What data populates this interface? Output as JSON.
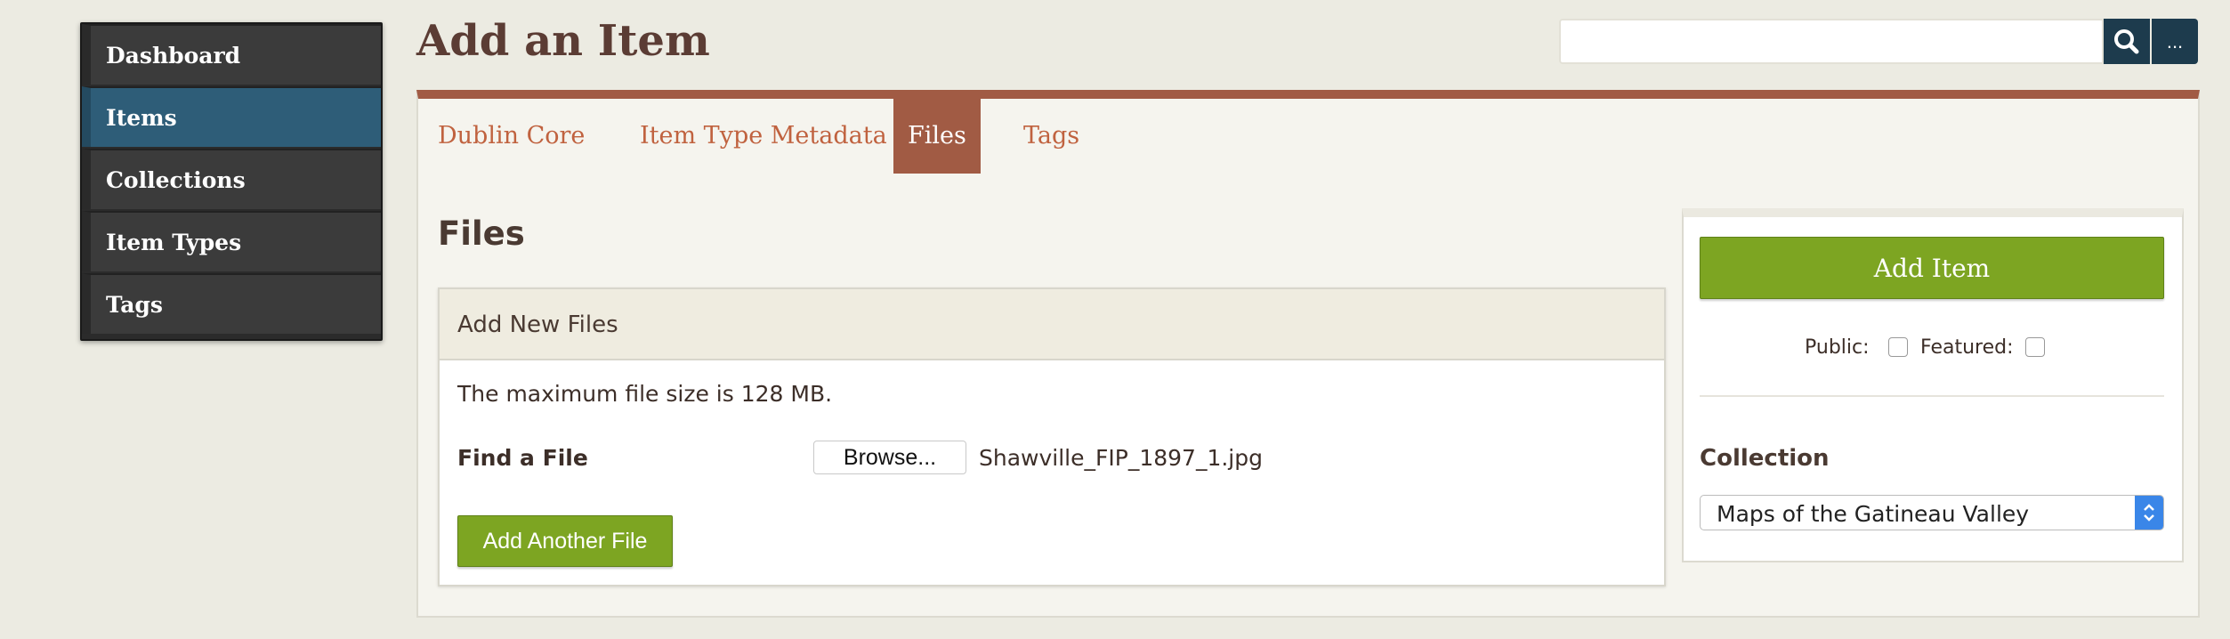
{
  "sidebar": {
    "items": [
      {
        "label": "Dashboard"
      },
      {
        "label": "Items"
      },
      {
        "label": "Collections"
      },
      {
        "label": "Item Types"
      },
      {
        "label": "Tags"
      }
    ]
  },
  "header": {
    "title": "Add an Item"
  },
  "search": {
    "value": "",
    "more_label": "..."
  },
  "tabs": [
    {
      "label": "Dublin Core"
    },
    {
      "label": "Item Type Metadata"
    },
    {
      "label": "Files"
    },
    {
      "label": "Tags"
    }
  ],
  "files": {
    "heading": "Files",
    "box_title": "Add New Files",
    "max_size_text": "The maximum file size is 128 MB.",
    "find_label": "Find a File",
    "browse_label": "Browse...",
    "file_name": "Shawville_FIP_1897_1.jpg",
    "add_another_label": "Add Another File"
  },
  "side_panel": {
    "add_item_label": "Add Item",
    "public_label": "Public:",
    "featured_label": "Featured:",
    "collection_label": "Collection",
    "collection_value": "Maps of the Gatineau Valley"
  },
  "colors": {
    "accent": "#a15b44",
    "active_nav": "#2e5d78",
    "primary_button": "#7da522",
    "search_button": "#1d3b4d"
  },
  "icons": {
    "search": "search-icon",
    "select_arrow": "chevron-up-down-icon"
  }
}
